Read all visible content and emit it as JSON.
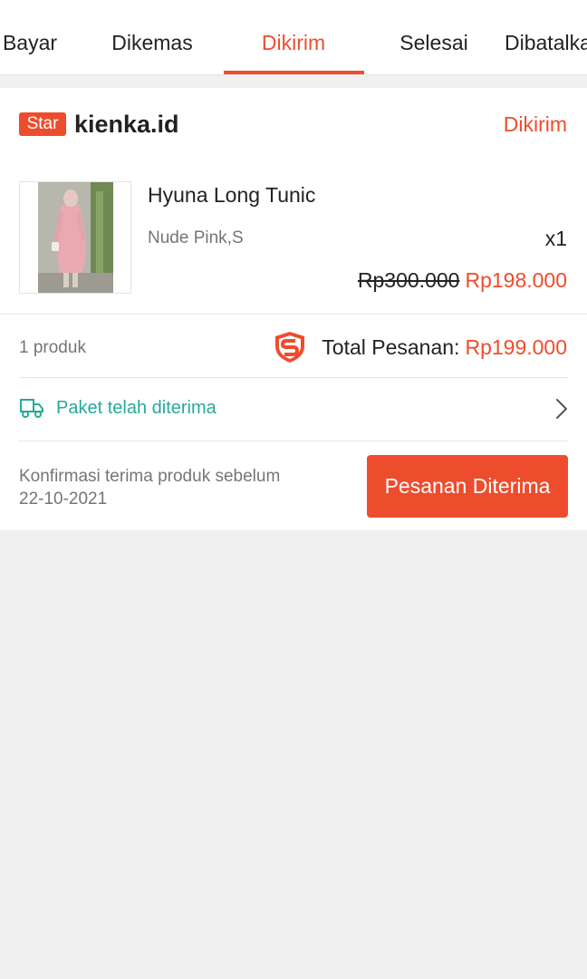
{
  "tabs": [
    {
      "label": "Bayar",
      "active": false
    },
    {
      "label": "Dikemas",
      "active": false
    },
    {
      "label": "Dikirim",
      "active": true
    },
    {
      "label": "Selesai",
      "active": false
    },
    {
      "label": "Dibatalkan",
      "active": false
    }
  ],
  "order": {
    "badge": "Star",
    "shop_name": "kienka.id",
    "status": "Dikirim",
    "product": {
      "name": "Hyuna Long Tunic",
      "variant": "Nude Pink,S",
      "quantity": "x1",
      "original_price": "Rp300.000",
      "price": "Rp198.000"
    },
    "product_count": "1 produk",
    "total_label": "Total Pesanan:",
    "total_value": "Rp199.000",
    "shipping_status": "Paket telah diterima",
    "confirm_note_line1": "Konfirmasi terima produk sebelum",
    "confirm_note_line2": "22-10-2021",
    "confirm_button": "Pesanan Diterima"
  },
  "icons": {
    "guarantee": "shopee-guarantee-shield-icon",
    "shipping": "truck-icon",
    "chevron": "chevron-right-icon"
  },
  "colors": {
    "accent": "#ee4d2d",
    "shipping": "#26aa99",
    "background": "#f0f0f0"
  }
}
